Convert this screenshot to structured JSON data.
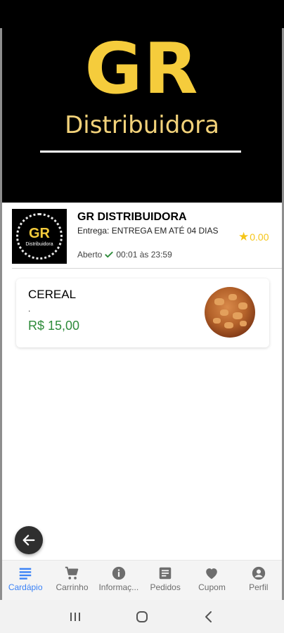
{
  "banner": {
    "logo_text": "GR",
    "logo_subtitle": "Distribuidora"
  },
  "store": {
    "logo_text": "GR",
    "logo_subtitle": "Distribuidora",
    "name": "GR DISTRIBUIDORA",
    "delivery": "Entrega: ENTREGA EM ATÉ 04 DIAS",
    "status": "Aberto",
    "hours": "00:01 às 23:59",
    "rating": "0.00"
  },
  "products": [
    {
      "name": "CEREAL",
      "description": ".",
      "price": "R$ 15,00",
      "image": "cereal-bowl"
    }
  ],
  "bottom_nav": [
    {
      "label": "Cardápio",
      "icon": "menu-lines-icon",
      "active": true
    },
    {
      "label": "Carrinho",
      "icon": "cart-icon",
      "active": false
    },
    {
      "label": "Informaç...",
      "icon": "info-icon",
      "active": false
    },
    {
      "label": "Pedidos",
      "icon": "receipt-icon",
      "active": false
    },
    {
      "label": "Cupom",
      "icon": "heart-icon",
      "active": false
    },
    {
      "label": "Perfil",
      "icon": "profile-icon",
      "active": false
    }
  ],
  "system_nav": [
    "recent-apps-icon",
    "home-icon",
    "back-icon"
  ],
  "colors": {
    "accent": "#3b82f6",
    "price": "#2e8b3a",
    "brand_yellow": "#f5cc3c",
    "rating": "#f5c518"
  }
}
